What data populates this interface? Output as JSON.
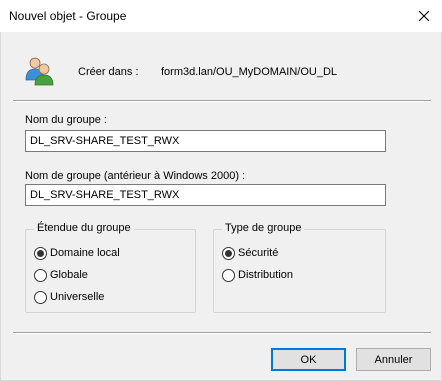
{
  "window": {
    "title": "Nouvel objet - Groupe"
  },
  "icons": {
    "users": "users-icon",
    "close": "close-icon"
  },
  "create": {
    "label": "Créer dans :",
    "path": "form3d.lan/OU_MyDOMAIN/OU_DL"
  },
  "group_name": {
    "label": "Nom du groupe :",
    "value": "DL_SRV-SHARE_TEST_RWX"
  },
  "group_name_legacy": {
    "label": "Nom de groupe (antérieur à Windows 2000) :",
    "value": "DL_SRV-SHARE_TEST_RWX"
  },
  "scope": {
    "title": "Étendue du groupe",
    "options": [
      {
        "label": "Domaine local",
        "selected": true
      },
      {
        "label": "Globale",
        "selected": false
      },
      {
        "label": "Universelle",
        "selected": false
      }
    ]
  },
  "type": {
    "title": "Type de groupe",
    "options": [
      {
        "label": "Sécurité",
        "selected": true
      },
      {
        "label": "Distribution",
        "selected": false
      }
    ]
  },
  "buttons": {
    "ok": "OK",
    "cancel": "Annuler"
  }
}
